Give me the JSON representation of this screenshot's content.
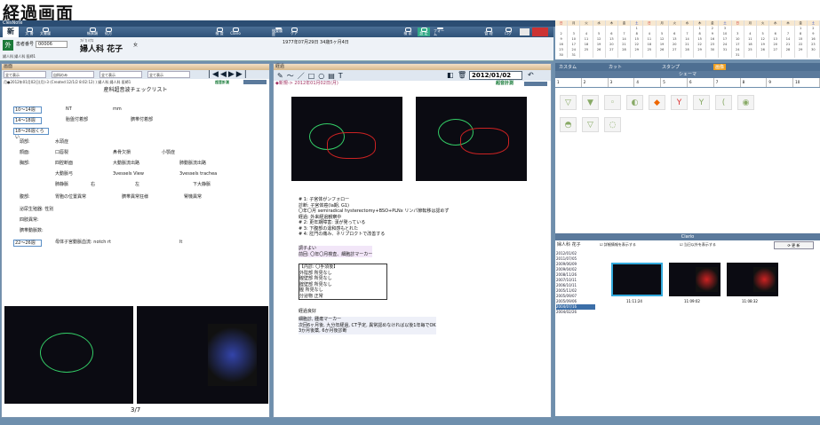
{
  "page_heading": "経過画面",
  "app_name": "ClesNote",
  "toolbar": [
    {
      "label": "新"
    },
    {
      "label": "文 書"
    },
    {
      "label": "文書履"
    },
    {
      "label": "帳票類"
    },
    {
      "label": "処方"
    },
    {
      "label": "検 査"
    },
    {
      "label": "Clario"
    },
    {
      "label": "検査履歴"
    },
    {
      "label": "ケア"
    },
    {
      "label": "検 索"
    },
    {
      "label": "設 定"
    },
    {
      "label": "フォーム"
    },
    {
      "label": "管 理"
    },
    {
      "label": "ログ"
    }
  ],
  "patient": {
    "dept": "外",
    "id_label": "患者番号",
    "id": "00006",
    "kana": "ﾌｼﾞｶ ﾊﾅｺ",
    "name": "婦人科 花子",
    "sex": "女",
    "birth": "1977年07月29日 34歳5ヶ月4日",
    "sub": "婦人科 婦人科 医師1"
  },
  "left": {
    "header": "画面",
    "filters": [
      "全て表示",
      "自科のみ",
      "全て表示",
      "全て表示"
    ],
    "record_line": "月●2012年01月02日(月)-3 (Created:12/1/2 8:02:12) ) 婦人科 婦人科 医師1",
    "tag": "超音計測",
    "title": "産科超音波チェックリスト",
    "weeks": [
      "10〜14週",
      "14〜18週",
      "18〜26週くらい",
      "22〜26週"
    ],
    "w1_val": "NT",
    "w1_unit": "mm",
    "w2_a": "胎盤付着部",
    "w2_b": "臍帯付着部",
    "rows": [
      [
        "頭部:",
        "水頭症",
        "",
        ""
      ],
      [
        "顔面:",
        "口唇裂",
        "鼻骨欠損",
        "小顎症"
      ],
      [
        "胸部:",
        "四腔断面",
        "大動脈流出路",
        "肺動脈流出路"
      ],
      [
        "",
        "大動脈弓",
        "3vessels View",
        "3vessels trachea"
      ],
      [
        "",
        "肺静脈",
        "右",
        "左",
        "下大静脈"
      ],
      [
        "腹部:",
        "胃胞の位置異常",
        "臍帯異常狂様",
        "腎機異常"
      ]
    ],
    "extra": [
      "泌尿生殖器: 性別",
      "四肢異常:",
      "臍帯動脈数:"
    ],
    "w4": "母体子宮動脈血流: notch rt",
    "w4_lt": "lt",
    "page": "3/7"
  },
  "mid": {
    "header": "経過",
    "date": "2012/01/02",
    "entry_header": "◆新規-> 2012年01月02日(月)",
    "tag": "超音計測",
    "notes": [
      "# 1: 子宮体がンフォロー",
      "診断: 子宮体癌(Ia期, G1)",
      "〇年〇月 semiradical hysterectomy+BSO+PLNx リンパ節転移は認めず",
      "経過: 外来経過観察中",
      "# 2: 更年期障害: 漢が発っている",
      "# 3: 下腹部の違和感もとれた",
      "# 4: 肛門の痛み、ネリプロクトで改善する"
    ],
    "note2": [
      "調子よい",
      "前回: 〇年〇月検査、細胞診マーカー"
    ],
    "note3": [
      "【内診: 〇手須後】",
      "外陰部 所見なし",
      "膣壁部 所見なし",
      "腟壁部 所見なし",
      "膣 所見なし",
      "分泌物 正常"
    ],
    "note4_title": "経過良好",
    "note4": [
      "細胞診, 腫瘍マーカー",
      "次回6ヶ月後, 九分年経過, CT予定, 異常認めなければ以後1年毎でOK",
      "3か月後薬, 6か月後診断"
    ]
  },
  "right": {
    "tabs": [
      "カスタム",
      "カット",
      "スタンプ",
      "画像"
    ],
    "sheme_title": "シェーマ",
    "sheme_nums": [
      "1",
      "2",
      "3",
      "4",
      "5",
      "6",
      "7",
      "8",
      "9",
      "10"
    ],
    "clario_title": "Clario",
    "clario_patient": "婦人科 花子",
    "clario_chk1": "詳細情報を表示する",
    "clario_chk2": "当日以外を表示する",
    "clario_refresh": "更 新",
    "clario_dates": [
      "2012/01/02",
      "2011/07/05",
      "2009/06/09",
      "2009/04/02",
      "2008/11/26",
      "2007/10/11",
      "2006/10/11",
      "2005/11/02",
      "2005/09/07",
      "2005/09/06",
      "2004/07/16",
      "2004/02/26"
    ],
    "times": [
      "11:11:24",
      "11:09:02",
      "11:08:32"
    ]
  },
  "calendar": {
    "headers": [
      "日",
      "月",
      "火",
      "水",
      "木",
      "金",
      "土",
      "日",
      "月",
      "火",
      "水",
      "木",
      "金",
      "土",
      "日",
      "月",
      "火",
      "水",
      "木",
      "金",
      "土"
    ],
    "rows": [
      [
        "",
        "",
        "",
        "",
        "",
        "",
        "1",
        "",
        "",
        "",
        "",
        "1",
        "2",
        "3",
        "",
        "",
        "",
        "",
        "",
        "1",
        "2"
      ],
      [
        "2",
        "3",
        "4",
        "5",
        "6",
        "7",
        "8",
        "4",
        "5",
        "6",
        "7",
        "8",
        "9",
        "10",
        "3",
        "4",
        "5",
        "6",
        "7",
        "8",
        "9"
      ],
      [
        "9",
        "10",
        "11",
        "12",
        "13",
        "14",
        "15",
        "11",
        "12",
        "13",
        "14",
        "15",
        "16",
        "17",
        "10",
        "11",
        "12",
        "13",
        "14",
        "15",
        "16"
      ],
      [
        "16",
        "17",
        "18",
        "19",
        "20",
        "21",
        "22",
        "18",
        "19",
        "20",
        "21",
        "22",
        "23",
        "24",
        "17",
        "18",
        "19",
        "20",
        "21",
        "22",
        "23"
      ],
      [
        "23",
        "24",
        "25",
        "26",
        "27",
        "28",
        "29",
        "25",
        "26",
        "27",
        "28",
        "29",
        "30",
        "31",
        "24",
        "25",
        "26",
        "27",
        "28",
        "29",
        "30"
      ],
      [
        "30",
        "31",
        "",
        "",
        "",
        "",
        "",
        "",
        "",
        "",
        "",
        "",
        "",
        "",
        "31",
        "",
        "",
        "",
        "",
        "",
        ""
      ]
    ]
  }
}
